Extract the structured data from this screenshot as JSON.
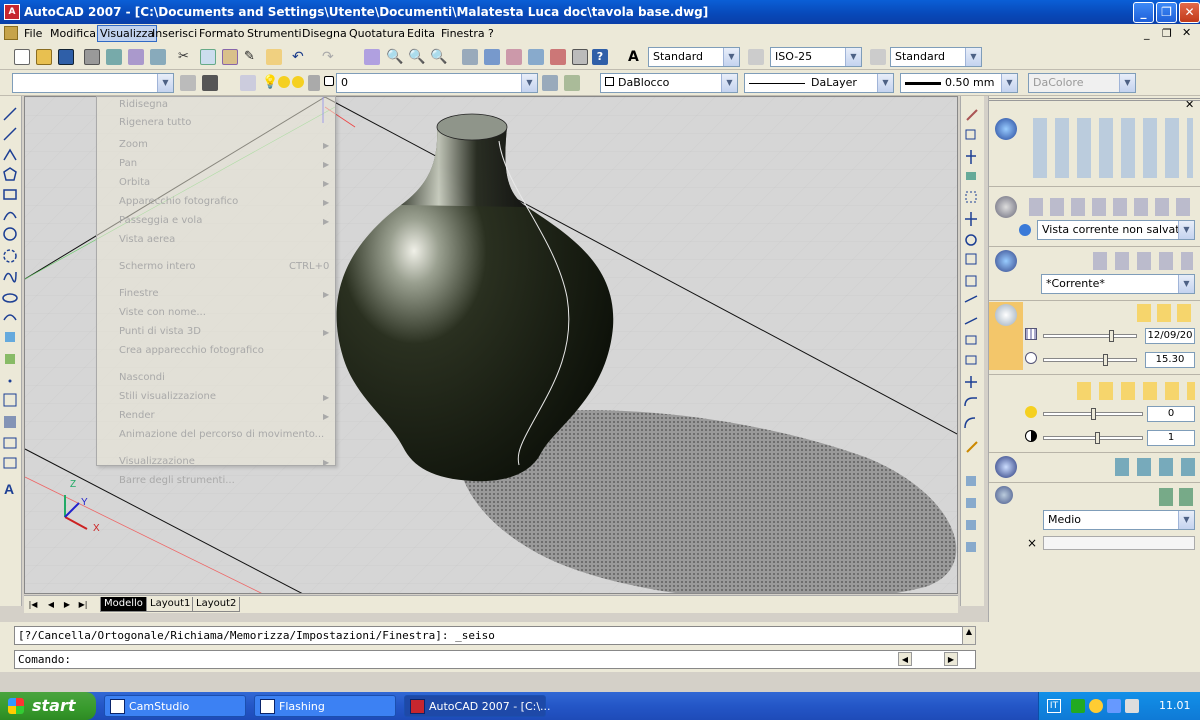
{
  "window": {
    "title": "AutoCAD 2007 - [C:\\Documents and Settings\\Utente\\Documenti\\Malatesta Luca doc\\tavola base.dwg]",
    "app_icon_text": "A"
  },
  "menubar": {
    "items": [
      "File",
      "Modifica",
      "Visualizza",
      "Inserisci",
      "Formato",
      "Strumenti",
      "Disegna",
      "Quotatura",
      "Edita",
      "Finestra",
      "?"
    ]
  },
  "toolbar1": {
    "text_style": "Standard",
    "dim_style": "ISO-25",
    "table_style": "Standard"
  },
  "toolbar2": {
    "workspace": "",
    "layer": "0",
    "color": "DaBlocco",
    "linetype": "DaLayer",
    "lineweight": "0.50 mm",
    "plotstyle": "DaColore"
  },
  "dropdown_menu": {
    "items": [
      {
        "label": "Ridisegna",
        "shortcut": "",
        "submenu": false
      },
      {
        "label": "Rigenera tutto",
        "shortcut": "",
        "submenu": false
      },
      {
        "label": "Zoom",
        "shortcut": "",
        "submenu": true
      },
      {
        "label": "Pan",
        "shortcut": "",
        "submenu": true
      },
      {
        "label": "Orbita",
        "shortcut": "",
        "submenu": true
      },
      {
        "label": "Apparecchio fotografico",
        "shortcut": "",
        "submenu": true
      },
      {
        "label": "Passeggia e vola",
        "shortcut": "",
        "submenu": true
      },
      {
        "label": "Vista aerea",
        "shortcut": "",
        "submenu": false
      },
      {
        "label": "Schermo intero",
        "shortcut": "CTRL+0",
        "submenu": false
      },
      {
        "label": "Finestre",
        "shortcut": "",
        "submenu": true
      },
      {
        "label": "Viste con nome...",
        "shortcut": "",
        "submenu": false
      },
      {
        "label": "Punti di vista 3D",
        "shortcut": "",
        "submenu": true
      },
      {
        "label": "Crea apparecchio fotografico",
        "shortcut": "",
        "submenu": false
      },
      {
        "label": "Nascondi",
        "shortcut": "",
        "submenu": false
      },
      {
        "label": "Stili visualizzazione",
        "shortcut": "",
        "submenu": true
      },
      {
        "label": "Render",
        "shortcut": "",
        "submenu": true
      },
      {
        "label": "Animazione del percorso di movimento...",
        "shortcut": "",
        "submenu": false
      },
      {
        "label": "Visualizzazione",
        "shortcut": "",
        "submenu": true
      },
      {
        "label": "Barre degli strumenti...",
        "shortcut": "",
        "submenu": false
      }
    ]
  },
  "layout_tabs": [
    "Modello",
    "Layout1",
    "Layout2"
  ],
  "nav_buttons": [
    "|◀",
    "◀",
    "▶",
    "▶|"
  ],
  "dashboard": {
    "view_name": "Vista corrente non salvata",
    "visual_style": "*Corrente*",
    "date_value": "12/09/20",
    "time_value": "15.30",
    "light_intensity": "0",
    "light_contrast": "1",
    "render_quality": "Medio",
    "close_icon": "×"
  },
  "command_line": {
    "history": "[?/Cancella/Ortogonale/Richiama/Memorizza/Impostazioni/Finestra]: _seiso",
    "prompt": "Comando:"
  },
  "taskbar": {
    "start_label": "start",
    "tasks": [
      {
        "label": "CamStudio",
        "active": false
      },
      {
        "label": "Flashing",
        "active": false
      },
      {
        "label": "AutoCAD 2007 - [C:\\...",
        "active": true
      }
    ],
    "clock": "11.01"
  },
  "ucs": {
    "x": "X",
    "y": "Y",
    "z": "Z"
  }
}
